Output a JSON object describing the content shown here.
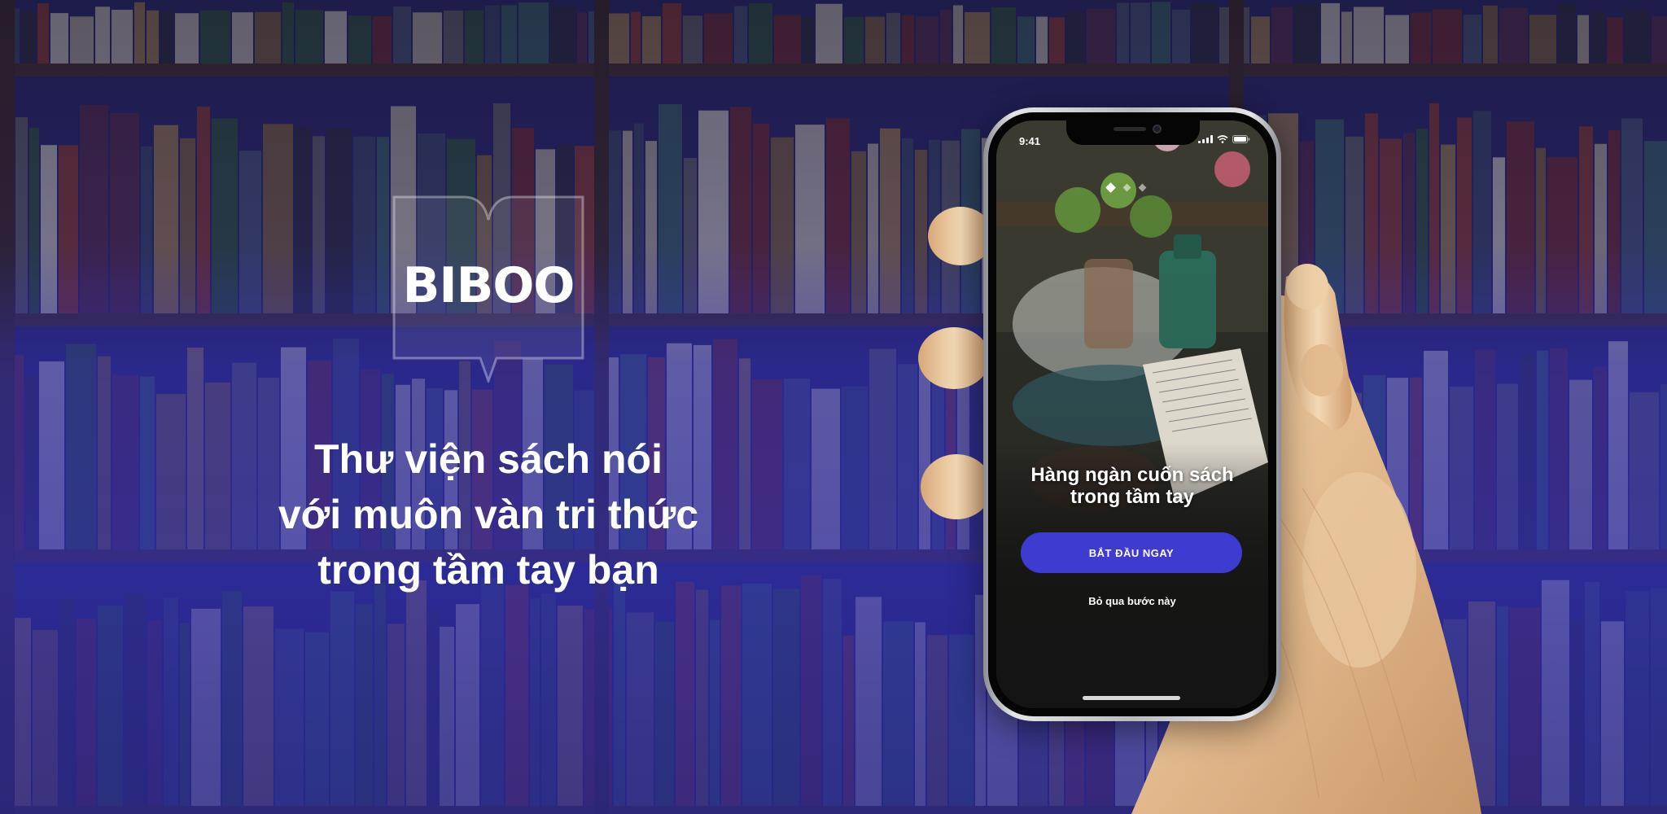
{
  "brand": {
    "name": "BIBOO"
  },
  "tagline": {
    "line1": "Thư viện sách nói",
    "line2": "với muôn vàn tri thức",
    "line3": "trong tầm tay bạn"
  },
  "phone": {
    "status_time": "9:41",
    "carousel": {
      "count": 3,
      "active_index": 0
    },
    "title_line1": "Hàng ngàn cuốn sách",
    "title_line2": "trong tầm tay",
    "start_button_label": "BẮT ĐẦU NGAY",
    "skip_label": "Bỏ qua bước này"
  },
  "colors": {
    "overlay_purple": "#2e2ca0",
    "button_blue": "#3d3bd0",
    "text_white": "#ffffff"
  },
  "icons": [
    "book-outline-icon",
    "signal-icon",
    "wifi-icon",
    "battery-icon"
  ]
}
